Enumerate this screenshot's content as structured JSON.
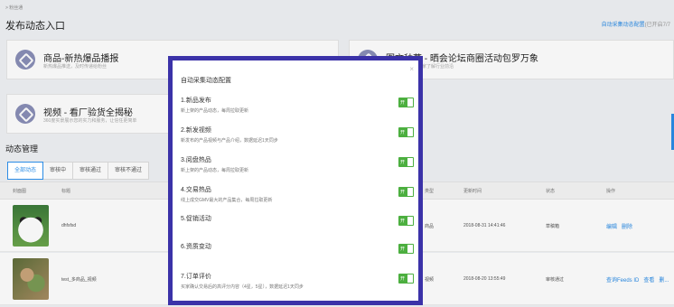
{
  "breadcrumb": "> 粉丝通",
  "page_title": "发布动态入口",
  "top_link": {
    "main": "自动采集动态配置",
    "status": "(已开启7/7"
  },
  "cards": [
    {
      "title": "商品-新热爆品播报",
      "sub": "新热爆品推送，及时传递给粉丝"
    },
    {
      "title": "图文种草 - 晒会论坛商圈活动包罗万象",
      "sub": "动向，帮助您的买家了解行业前沿"
    },
    {
      "title": "视频 - 看厂验货全揭秘",
      "sub": "360度实景展示您的实力和服务，让信任更简单"
    }
  ],
  "section_title": "动态管理",
  "tabs": [
    "全部动态",
    "审核中",
    "审核通过",
    "审核不通过"
  ],
  "table": {
    "headers": {
      "cover": "封面图",
      "title": "标题",
      "type": "类型",
      "time": "更新时间",
      "status": "状态",
      "ops": "操作"
    },
    "rows": [
      {
        "title": "dhfsfsd",
        "type": "商品",
        "time": "2018-08-31 14:41:46",
        "status": "草稿箱",
        "ops": [
          "编辑",
          "删除"
        ]
      },
      {
        "title": "test_多商品_视频",
        "type": "视频",
        "time": "2018-08-20 13:55:49",
        "status": "审核通过",
        "ops": [
          "查询Feeds ID",
          "查看",
          "删..."
        ]
      }
    ]
  },
  "modal": {
    "title": "自动采集动态配置",
    "close": "×",
    "items": [
      {
        "name": "1.新品发布",
        "desc": "新上架的产品动态，每周拉取更新",
        "toggle": "开"
      },
      {
        "name": "2.新发视频",
        "desc": "新发布的产品视频与产品介绍，数据延迟1天同步",
        "toggle": "开"
      },
      {
        "name": "3.阅盘热品",
        "desc": "新上架的产品动态，每周拉取更新",
        "toggle": "开"
      },
      {
        "name": "4.交易热品",
        "desc": "线上成交GMV最大的产品集合，每周拉取更新",
        "toggle": "开"
      },
      {
        "name": "5.促销活动",
        "desc": "",
        "toggle": "开"
      },
      {
        "name": "6.资质变动",
        "desc": "",
        "toggle": "开"
      },
      {
        "name": "7.订单评价",
        "desc": "买家确认交易后的高评分内容（4星，5星），数据延迟1天同步",
        "toggle": "开"
      }
    ]
  }
}
